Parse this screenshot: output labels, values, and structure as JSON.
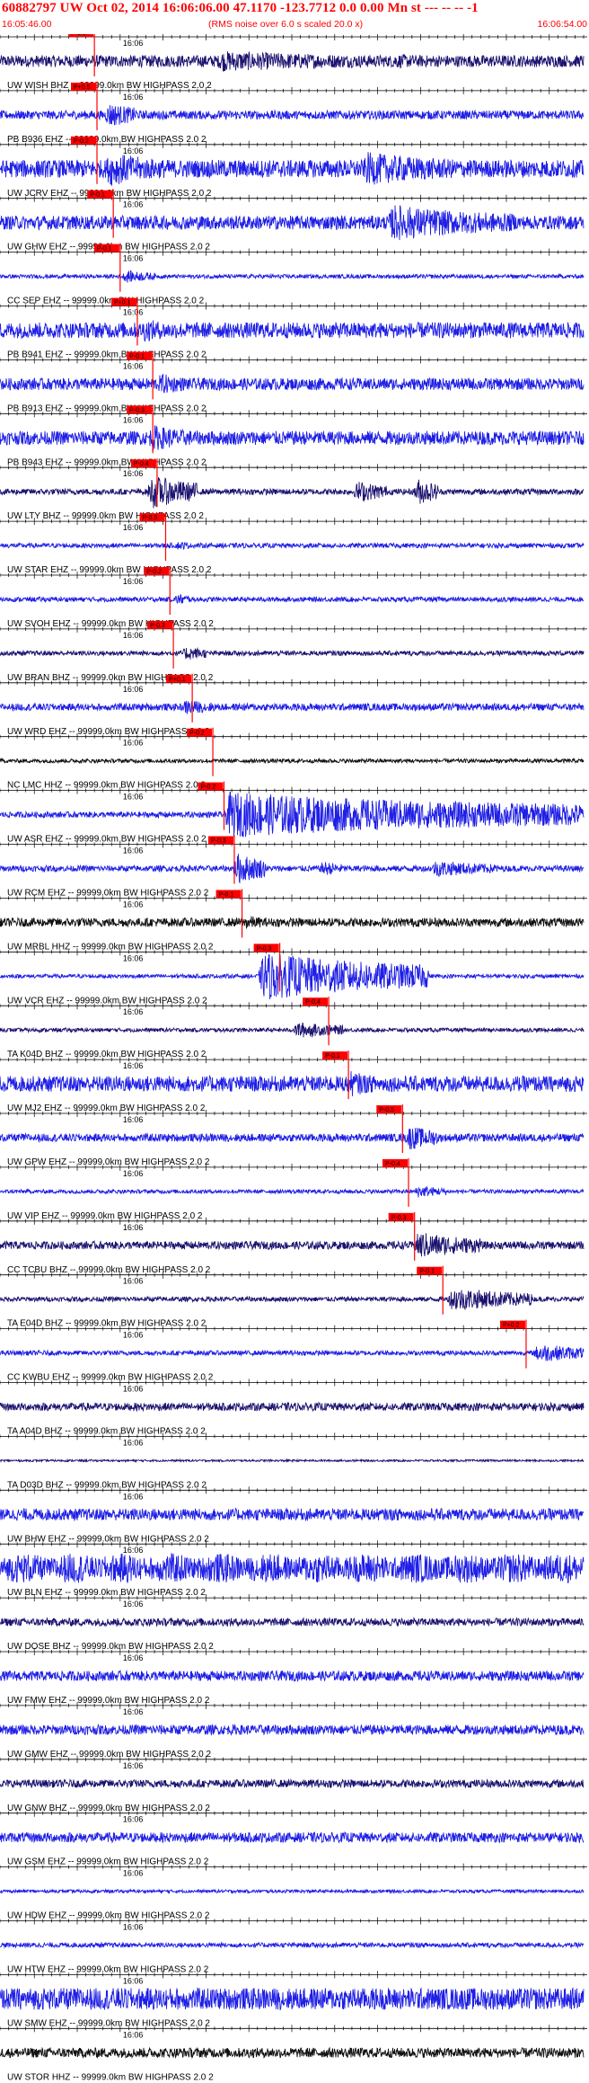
{
  "header": {
    "title": "60882797 UW Oct 02, 2014 16:06:06.00   47.1170 -123.7712  0.0 0.00 Mn st --- -- --  -1",
    "start_time": "16:05:46.00",
    "rms_note": "(RMS noise over 6.0 s scaled 20.0 x)",
    "end_time": "16:06:54.00"
  },
  "chart_data": {
    "type": "line",
    "title": "60882797 UW Oct 02, 2014 16:06:06.00   47.1170 -123.7712  0.0 0.00 Mn st --- -- --  -1",
    "x_axis": {
      "start": "16:05:46.00",
      "end": "16:06:54.00",
      "minute_label": "16:06",
      "unit": "s"
    },
    "filter_label": "99999.0km BW  HIGHPASS  2.0  2",
    "colors": {
      "navy": "#1c1370",
      "blue": "#1f1fe6",
      "black": "#111111",
      "red": "#ff0000"
    },
    "traces": [
      {
        "station": "UW WISH BHZ",
        "label": "UW WISH BHZ -- 99999.0km BW  HIGHPASS  2.0  2",
        "color": "navy",
        "pick_s": 11.0,
        "pick_label": "P-0.5",
        "amp": 0.3,
        "events": [
          [
            25,
            55,
            0.55
          ],
          [
            45,
            60,
            0.4
          ]
        ]
      },
      {
        "station": "PB B936 EHZ",
        "label": "PB B936 EHZ -- 99999.0km BW  HIGHPASS  2.0  2",
        "color": "blue",
        "pick_s": 11.3,
        "pick_label": "P+0.5",
        "amp": 0.22,
        "events": [
          [
            12,
            16,
            0.8
          ]
        ]
      },
      {
        "station": "UW JCRV EHZ",
        "label": "UW JCRV EHZ -- 99999.0km BW  HIGHPASS  2.0  2",
        "color": "blue",
        "pick_s": 11.3,
        "pick_label": "P-0.2",
        "amp": 0.45,
        "events": [
          [
            12,
            20,
            1.0
          ],
          [
            42,
            58,
            0.9
          ]
        ]
      },
      {
        "station": "UW GHW EHZ",
        "label": "UW GHW EHZ -- 99999.0km BW  HIGHPASS  2.0  2",
        "color": "blue",
        "pick_s": 13.2,
        "pick_label": "P-0.1",
        "amp": 0.35,
        "events": [
          [
            45,
            60,
            1.0
          ]
        ]
      },
      {
        "station": "CC SEP EHZ",
        "label": "CC SEP EHZ -- 99999.0km BW  HIGHPASS  2.0  2",
        "color": "blue",
        "pick_s": 14.0,
        "pick_label": "P-0.1",
        "amp": 0.1,
        "events": [
          [
            14,
            18,
            0.4
          ]
        ]
      },
      {
        "station": "PB B941 EHZ",
        "label": "PB B941 EHZ -- 99999.0km BW  HIGHPASS  2.0  2",
        "color": "blue",
        "pick_s": 16.0,
        "pick_label": "P+0.1",
        "amp": 0.4,
        "events": [
          [
            16,
            22,
            0.7
          ]
        ]
      },
      {
        "station": "PB B913 EHZ",
        "label": "PB B913 EHZ -- 99999.0km BW  HIGHPASS  2.0  2",
        "color": "blue",
        "pick_s": 17.8,
        "pick_label": "P-0.1",
        "amp": 0.3,
        "events": [
          [
            18,
            22,
            0.7
          ]
        ]
      },
      {
        "station": "PB B943 EHZ",
        "label": "PB B943 EHZ -- 99999.0km BW  HIGHPASS  2.0  2",
        "color": "blue",
        "pick_s": 17.8,
        "pick_label": "P-0.3",
        "amp": 0.35,
        "events": [
          [
            17,
            23,
            0.8
          ]
        ]
      },
      {
        "station": "UW LTY BHZ",
        "label": "UW LTY BHZ -- 99999.0km BW  HIGHPASS  2.0  2",
        "color": "navy",
        "pick_s": 18.3,
        "pick_label": "P-0.4",
        "amp": 0.15,
        "events": [
          [
            17,
            23,
            1.0
          ],
          [
            41,
            45,
            0.7
          ],
          [
            48,
            51,
            0.9
          ]
        ]
      },
      {
        "station": "UW STAR EHZ",
        "label": "UW STAR EHZ -- 99999.0km BW  HIGHPASS  2.0  2",
        "color": "blue",
        "pick_s": 19.3,
        "pick_label": "P-0.5",
        "amp": 0.12,
        "events": [
          [
            20,
            22,
            0.3
          ]
        ]
      },
      {
        "station": "UW SVOH EHZ",
        "label": "UW SVOH EHZ -- 99999.0km BW  HIGHPASS  2.0  2",
        "color": "blue",
        "pick_s": 19.8,
        "pick_label": "P-0.2",
        "amp": 0.12,
        "events": [
          [
            20,
            22,
            0.4
          ]
        ]
      },
      {
        "station": "UW BRAN BHZ",
        "label": "UW BRAN BHZ -- 99999.0km BW  HIGHPASS  2.0  2",
        "color": "navy",
        "pick_s": 20.2,
        "pick_label": "P-0.3",
        "amp": 0.12,
        "events": [
          [
            21,
            24,
            0.5
          ],
          [
            40,
            42,
            0.2
          ]
        ]
      },
      {
        "station": "UW WRD EHZ",
        "label": "UW WRD EHZ -- 99999.0km BW  HIGHPASS  2.0  2",
        "color": "blue",
        "pick_s": 22.4,
        "pick_label": "P+0.1",
        "amp": 0.18,
        "events": [
          [
            21,
            25,
            0.5
          ]
        ]
      },
      {
        "station": "NC LMC HHZ",
        "label": "NC LMC HHZ -- 99999.0km BW  HIGHPASS  2.0  2",
        "color": "black",
        "pick_s": 24.8,
        "pick_label": "P-0.2",
        "amp": 0.1,
        "events": []
      },
      {
        "station": "UW ASR EHZ",
        "label": "UW ASR EHZ -- 99999.0km BW  HIGHPASS  2.0  2",
        "color": "blue",
        "pick_s": 26.1,
        "pick_label": "P-0.2",
        "amp": 0.15,
        "events": [
          [
            26,
            68,
            1.2
          ]
        ]
      },
      {
        "station": "UW RCM EHZ",
        "label": "UW RCM EHZ -- 99999.0km BW  HIGHPASS  2.0  2",
        "color": "blue",
        "pick_s": 27.3,
        "pick_label": "P-0.3",
        "amp": 0.15,
        "events": [
          [
            27,
            31,
            1.0
          ],
          [
            37,
            40,
            0.5
          ],
          [
            50,
            58,
            0.5
          ]
        ]
      },
      {
        "station": "UW MRBL HHZ",
        "label": "UW MRBL HHZ -- 99999.0km BW  HIGHPASS  2.0  2",
        "color": "black",
        "pick_s": 28.2,
        "pick_label": "P-0.1",
        "amp": 0.22,
        "events": [
          [
            28,
            31,
            0.5
          ]
        ]
      },
      {
        "station": "UW VCR EHZ",
        "label": "UW VCR EHZ -- 99999.0km BW  HIGHPASS  2.0  2",
        "color": "blue",
        "pick_s": 32.6,
        "pick_label": "P-0.3",
        "amp": 0.1,
        "events": [
          [
            30,
            50,
            1.3
          ]
        ]
      },
      {
        "station": "TA K04D BHZ",
        "label": "TA K04D BHZ -- 99999.0km BW  HIGHPASS  2.0  2",
        "color": "navy",
        "pick_s": 38.3,
        "pick_label": "P-0.4",
        "amp": 0.1,
        "events": [
          [
            34,
            40,
            0.5
          ]
        ]
      },
      {
        "station": "UW MJ2 EHZ",
        "label": "UW MJ2 EHZ -- 99999.0km BW  HIGHPASS  2.0  2",
        "color": "blue",
        "pick_s": 40.6,
        "pick_label": "P-0.1",
        "amp": 0.4,
        "events": [
          [
            40,
            45,
            0.8
          ]
        ]
      },
      {
        "station": "UW GPW EHZ",
        "label": "UW GPW EHZ -- 99999.0km BW  HIGHPASS  2.0  2",
        "color": "blue",
        "pick_s": 46.9,
        "pick_label": "P-0.5",
        "amp": 0.2,
        "events": [
          [
            47,
            51,
            0.8
          ]
        ]
      },
      {
        "station": "UW VIP EHZ",
        "label": "UW VIP EHZ -- 99999.0km BW  HIGHPASS  2.0  2",
        "color": "blue",
        "pick_s": 47.6,
        "pick_label": "P-0.4",
        "amp": 0.1,
        "events": [
          [
            48,
            52,
            0.4
          ]
        ]
      },
      {
        "station": "CC TCBU BHZ",
        "label": "CC TCBU BHZ -- 99999.0km BW  HIGHPASS  2.0  2",
        "color": "navy",
        "pick_s": 48.3,
        "pick_label": "P-0.3",
        "amp": 0.2,
        "events": [
          [
            48,
            56,
            0.8
          ]
        ]
      },
      {
        "station": "TA E04D BHZ",
        "label": "TA E04D BHZ -- 99999.0km BW  HIGHPASS  2.0  2",
        "color": "navy",
        "pick_s": 51.6,
        "pick_label": "P-0.1",
        "amp": 0.12,
        "events": [
          [
            52,
            62,
            0.7
          ]
        ]
      },
      {
        "station": "CC KWBU EHZ",
        "label": "CC KWBU EHZ -- 99999.0km BW  HIGHPASS  2.0  2",
        "color": "blue",
        "pick_s": 61.3,
        "pick_label": "P+0.2",
        "amp": 0.12,
        "events": [
          [
            62,
            68,
            0.6
          ]
        ]
      },
      {
        "station": "TA A04D BHZ",
        "label": "TA A04D BHZ -- 99999.0km BW  HIGHPASS  2.0  2",
        "color": "navy",
        "pick_s": null,
        "pick_label": "",
        "amp": 0.2,
        "events": []
      },
      {
        "station": "TA D03D BHZ",
        "label": "TA D03D BHZ -- 99999.0km BW  HIGHPASS  2.0  2",
        "color": "navy",
        "pick_s": null,
        "pick_label": "",
        "amp": 0.05,
        "events": []
      },
      {
        "station": "UW BHW EHZ",
        "label": "UW BHW EHZ -- 99999.0km BW  HIGHPASS  2.0  2",
        "color": "blue",
        "pick_s": null,
        "pick_label": "",
        "amp": 0.3,
        "events": []
      },
      {
        "station": "UW BLN EHZ",
        "label": "UW BLN EHZ -- 99999.0km BW  HIGHPASS  2.0  2",
        "color": "blue",
        "pick_s": null,
        "pick_label": "",
        "amp": 0.75,
        "events": []
      },
      {
        "station": "UW DOSE BHZ",
        "label": "UW DOSE BHZ -- 99999.0km BW  HIGHPASS  2.0  2",
        "color": "navy",
        "pick_s": null,
        "pick_label": "",
        "amp": 0.2,
        "events": []
      },
      {
        "station": "UW FMW EHZ",
        "label": "UW FMW EHZ -- 99999.0km BW  HIGHPASS  2.0  2",
        "color": "blue",
        "pick_s": null,
        "pick_label": "",
        "amp": 0.25,
        "events": []
      },
      {
        "station": "UW GMW EHZ",
        "label": "UW GMW EHZ -- 99999.0km BW  HIGHPASS  2.0  2",
        "color": "blue",
        "pick_s": null,
        "pick_label": "",
        "amp": 0.25,
        "events": []
      },
      {
        "station": "UW GNW BHZ",
        "label": "UW GNW BHZ -- 99999.0km BW  HIGHPASS  2.0  2",
        "color": "navy",
        "pick_s": null,
        "pick_label": "",
        "amp": 0.2,
        "events": []
      },
      {
        "station": "UW GSM EHZ",
        "label": "UW GSM EHZ -- 99999.0km BW  HIGHPASS  2.0  2",
        "color": "blue",
        "pick_s": null,
        "pick_label": "",
        "amp": 0.25,
        "events": [
          [
            38,
            42,
            0.2
          ]
        ]
      },
      {
        "station": "UW HDW EHZ",
        "label": "UW HDW EHZ -- 99999.0km BW  HIGHPASS  2.0  2",
        "color": "blue",
        "pick_s": null,
        "pick_label": "",
        "amp": 0.08,
        "events": []
      },
      {
        "station": "UW HTW EHZ",
        "label": "UW HTW EHZ -- 99999.0km BW  HIGHPASS  2.0  2",
        "color": "blue",
        "pick_s": null,
        "pick_label": "",
        "amp": 0.12,
        "events": []
      },
      {
        "station": "UW SMW EHZ",
        "label": "UW SMW EHZ -- 99999.0km BW  HIGHPASS  2.0  2",
        "color": "blue",
        "pick_s": null,
        "pick_label": "",
        "amp": 0.55,
        "events": []
      },
      {
        "station": "UW STOR HHZ",
        "label": "UW STOR HHZ -- 99999.0km BW  HIGHPASS  2.0  2",
        "color": "black",
        "pick_s": null,
        "pick_label": "",
        "amp": 0.25,
        "events": []
      }
    ]
  }
}
